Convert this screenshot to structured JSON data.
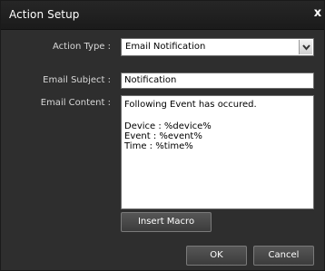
{
  "window": {
    "title": "Action Setup",
    "close_glyph": "x"
  },
  "form": {
    "action_type": {
      "label": "Action Type :",
      "value": "Email Notification"
    },
    "email_subject": {
      "label": "Email Subject :",
      "value": "Notification"
    },
    "email_content": {
      "label": "Email Content :",
      "lines": [
        "Following Event has occured.",
        "",
        "Device : %device%",
        "Event : %event%",
        "Time : %time%"
      ]
    }
  },
  "buttons": {
    "insert_macro": "Insert Macro",
    "ok": "OK",
    "cancel": "Cancel"
  },
  "icons": {
    "close": "close-icon",
    "dropdown": "chevron-down-icon"
  }
}
